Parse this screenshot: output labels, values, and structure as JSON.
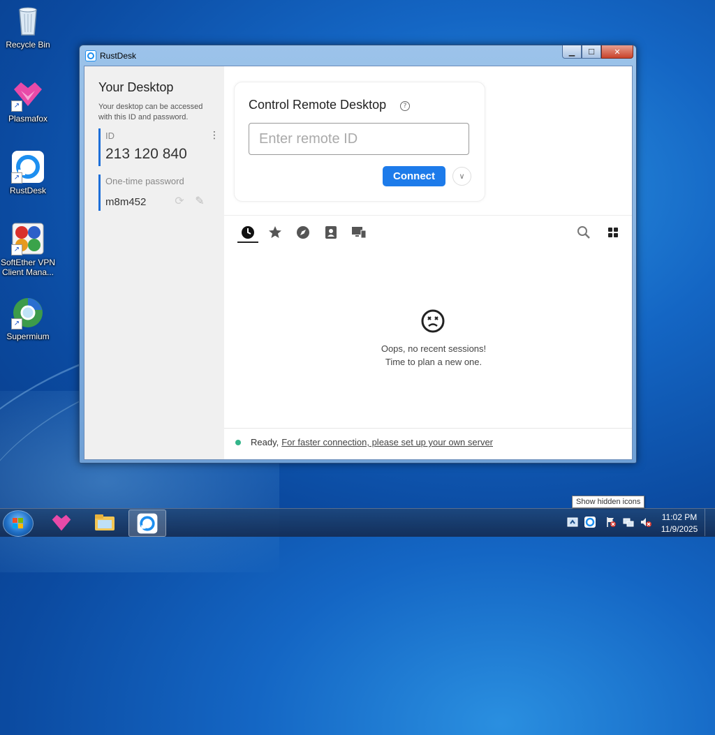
{
  "desktop": {
    "icons": [
      {
        "label": "Recycle Bin",
        "icon": "recycle-bin-icon"
      },
      {
        "label": "Plasmafox",
        "icon": "plasmafox-icon"
      },
      {
        "label": "RustDesk",
        "icon": "rustdesk-icon"
      },
      {
        "label": "SoftEther VPN Client Mana...",
        "icon": "softether-icon"
      },
      {
        "label": "Supermium",
        "icon": "supermium-icon"
      }
    ]
  },
  "window": {
    "title": "RustDesk",
    "minimize": "▁",
    "maximize": "☐",
    "close": "✕"
  },
  "left_panel": {
    "heading": "Your Desktop",
    "description": "Your desktop can be accessed with this ID and password.",
    "id_caption": "ID",
    "id_value": "213 120 840",
    "password_caption": "One-time password",
    "password_value": "m8m452"
  },
  "control": {
    "title": "Control Remote Desktop",
    "input_placeholder": "Enter remote ID",
    "input_value": "",
    "connect_label": "Connect"
  },
  "tabs": [
    {
      "name": "recent-sessions",
      "icon": "clock-icon",
      "active": true
    },
    {
      "name": "favorites",
      "icon": "star-icon",
      "active": false
    },
    {
      "name": "discovered",
      "icon": "compass-icon",
      "active": false
    },
    {
      "name": "address-book",
      "icon": "address-book-icon",
      "active": false
    },
    {
      "name": "group",
      "icon": "devices-icon",
      "active": false
    }
  ],
  "empty_state": {
    "line1": "Oops, no recent sessions!",
    "line2": "Time to plan a new one."
  },
  "status": {
    "text": "Ready,",
    "link": "For faster connection, please set up your own server",
    "color": "#33b58a"
  },
  "taskbar": {
    "tooltip": "Show hidden icons",
    "time": "11:02 PM",
    "date": "11/9/2025"
  },
  "colors": {
    "accent": "#1d7bea",
    "id_bar": "#1d6fd8"
  }
}
